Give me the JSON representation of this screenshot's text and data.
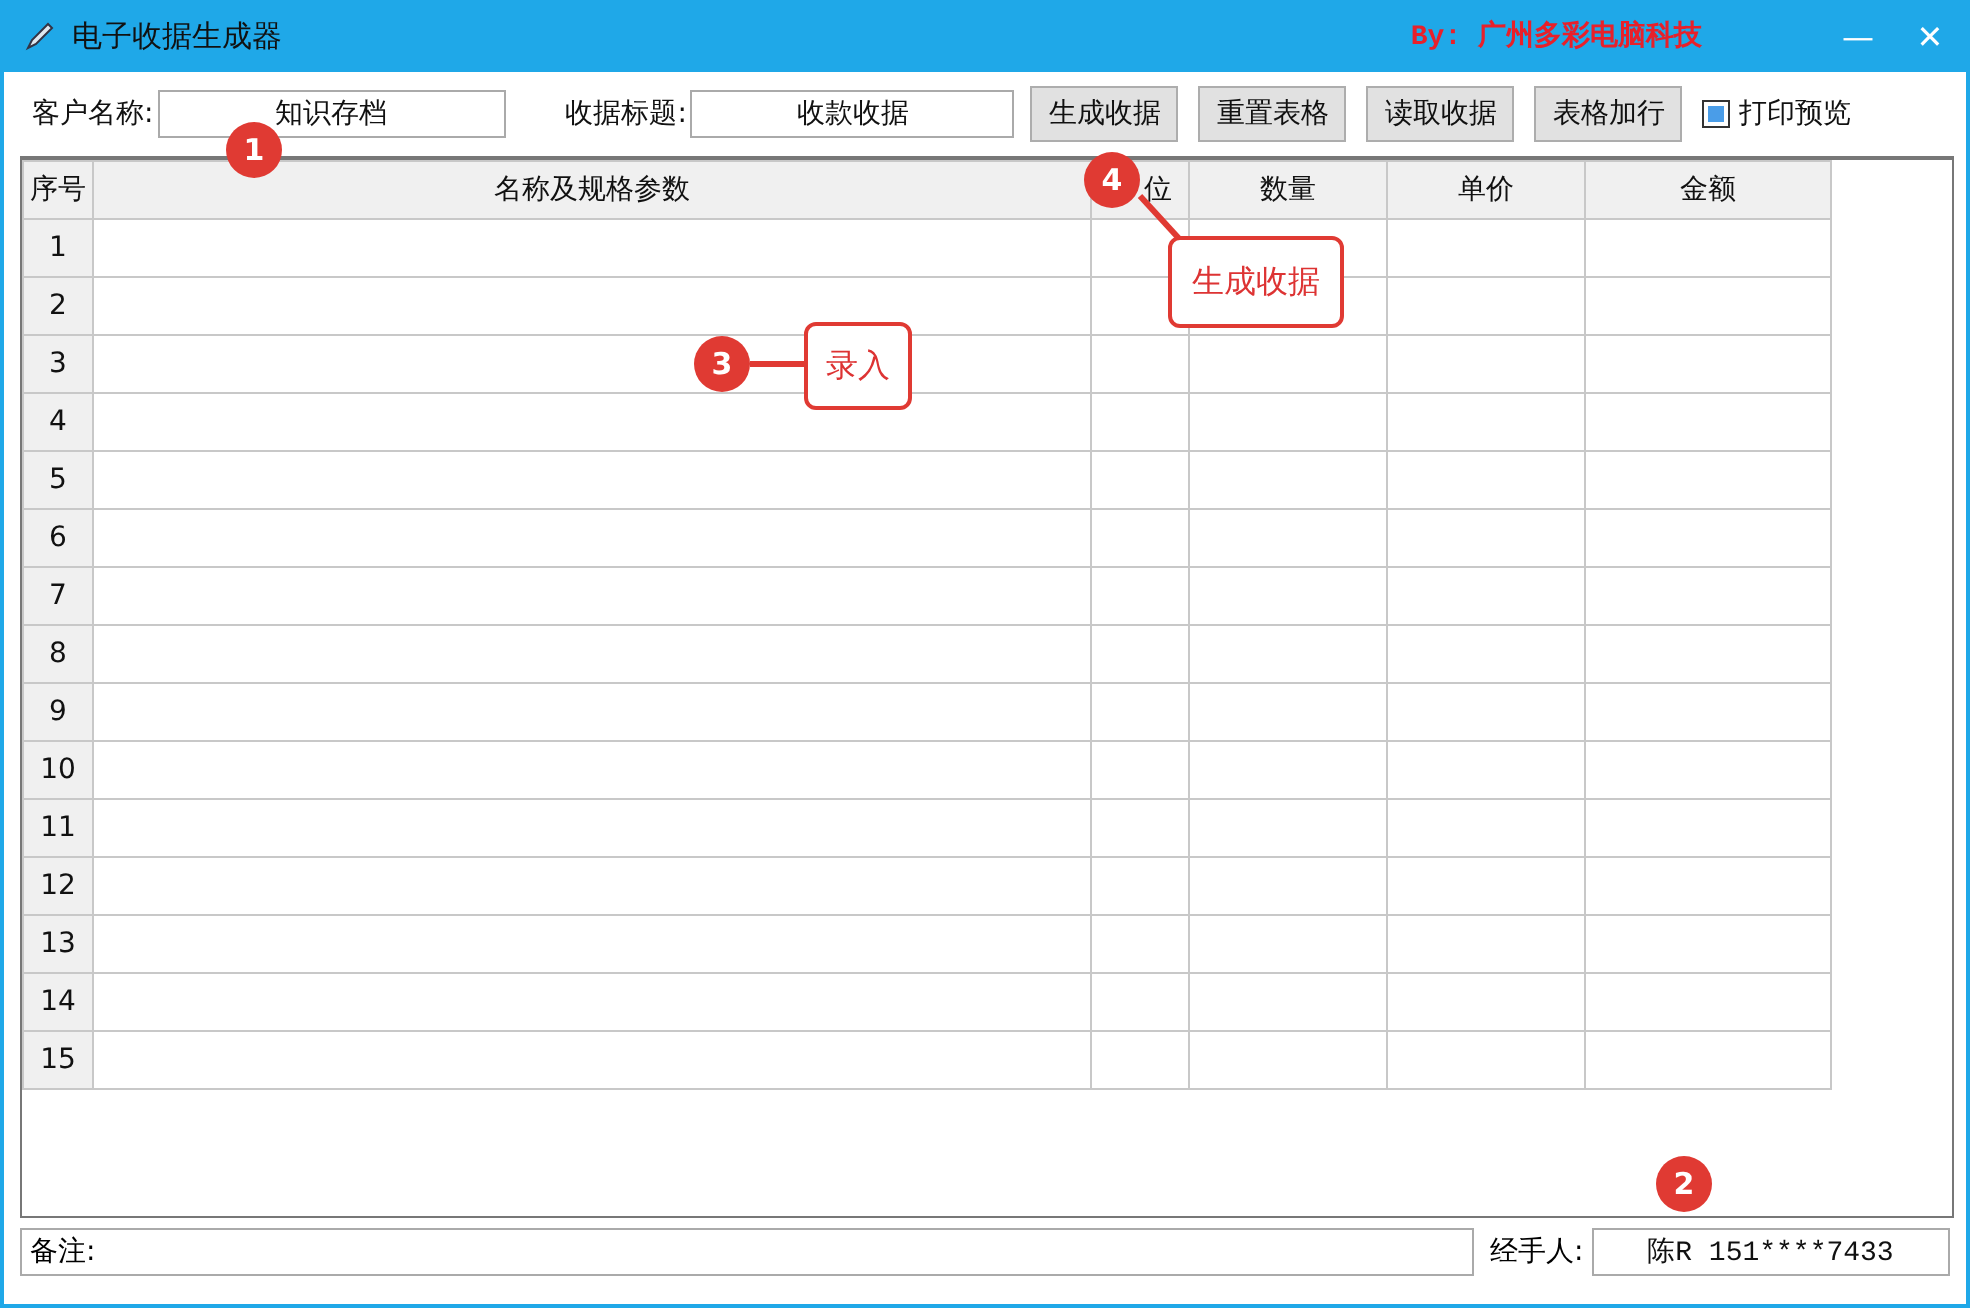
{
  "window": {
    "title": "电子收据生成器",
    "credit": "By: 广州多彩电脑科技",
    "buttons": [
      "—",
      "✕"
    ]
  },
  "toolbar": {
    "customer_label": "客户名称:",
    "customer_value": "知识存档",
    "title_label": "收据标题:",
    "title_value": "收款收据",
    "buttons": [
      "生成收据",
      "重置表格",
      "读取收据",
      "表格加行"
    ],
    "print_preview": {
      "label": "打印预览",
      "checked": true
    }
  },
  "table": {
    "columns": [
      "序号",
      "名称及规格参数",
      "位",
      "数量",
      "单价",
      "金额"
    ],
    "rows": [
      "1",
      "2",
      "3",
      "4",
      "5",
      "6",
      "7",
      "8",
      "9",
      "10",
      "11",
      "12",
      "13",
      "14",
      "15"
    ]
  },
  "footer": {
    "remark_label": "备注:",
    "handler_label": "经手人:",
    "handler_value": "陈R 151****7433"
  },
  "annotations": [
    {
      "number": "1",
      "kind": "badge"
    },
    {
      "number": "4",
      "kind": "callout",
      "label": "生成收据"
    },
    {
      "number": "3",
      "kind": "callout",
      "label": "录入"
    },
    {
      "number": "2",
      "kind": "badge"
    }
  ]
}
